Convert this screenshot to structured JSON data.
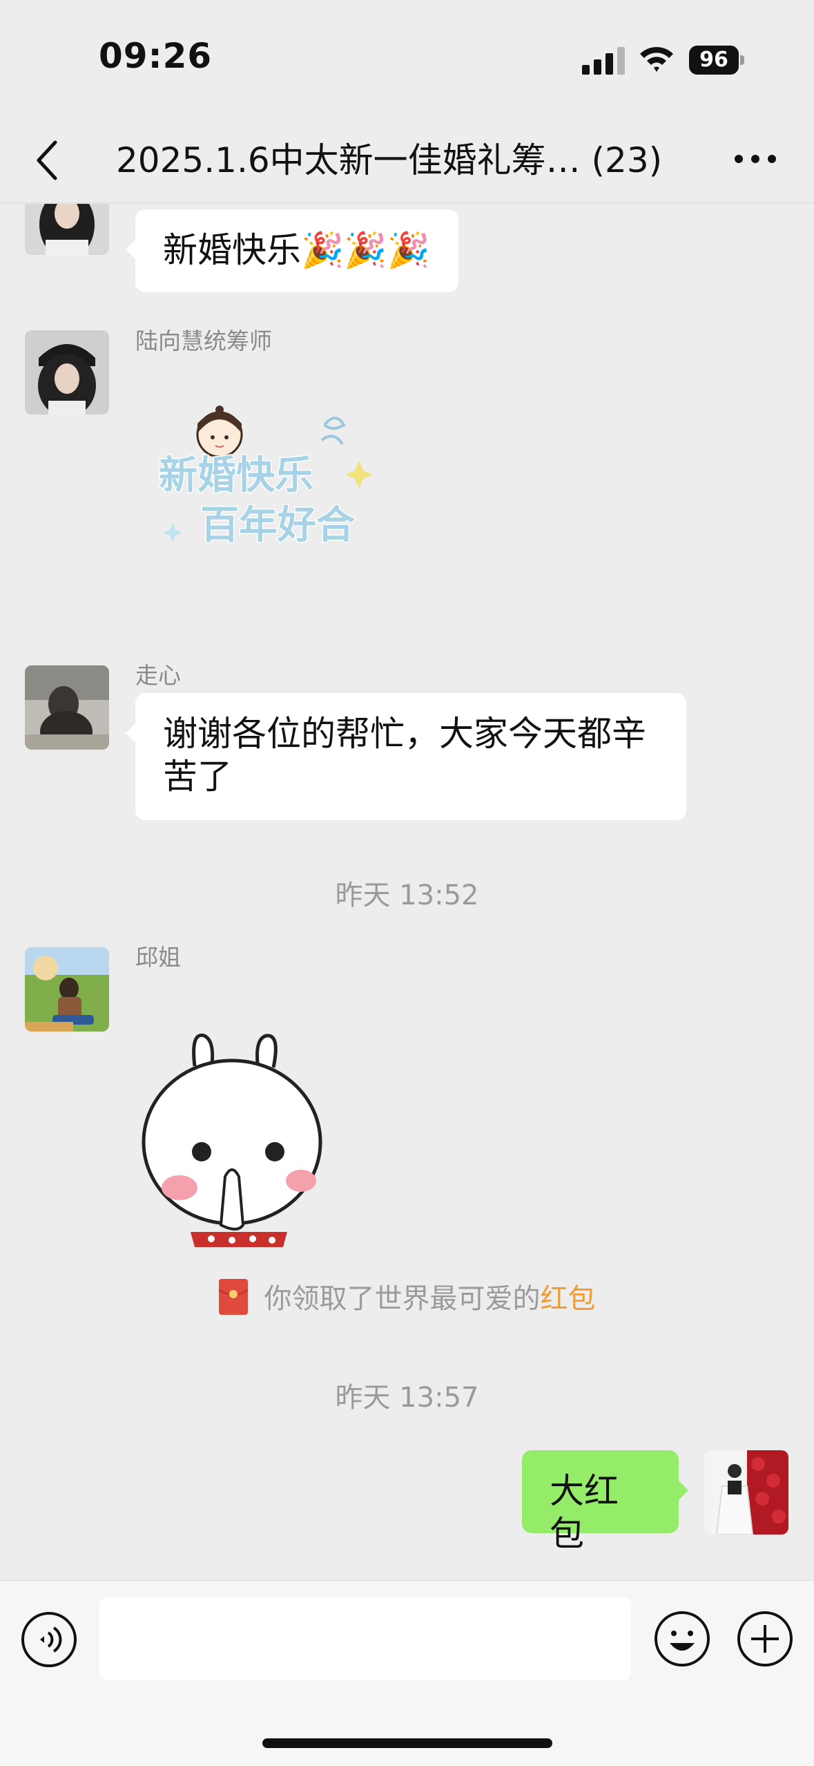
{
  "status_bar": {
    "time": "09:26",
    "battery": "96"
  },
  "header": {
    "title": "2025.1.6中太新一佳婚礼筹… (23)"
  },
  "messages": [
    {
      "type": "text",
      "text": "新婚快乐🎉🎉🎉"
    },
    {
      "type": "sticker",
      "sender": "陆向慧统筹师",
      "sticker_text_line1": "新婚快乐",
      "sticker_text_line2": "百年好合"
    },
    {
      "type": "text",
      "sender": "走心",
      "text_line1": "谢谢各位的帮忙，大家今天都辛",
      "text_line2": "苦了"
    },
    {
      "type": "timestamp",
      "text": "昨天 13:52"
    },
    {
      "type": "sticker",
      "sender": "邱姐"
    },
    {
      "type": "system",
      "prefix": "你领取了世界最可爱的",
      "link": "红包"
    },
    {
      "type": "timestamp",
      "text": "昨天 13:57"
    },
    {
      "type": "text",
      "outgoing": true,
      "text": "大红包"
    }
  ],
  "input_bar": {
    "placeholder": ""
  },
  "colors": {
    "outgoing_bubble": "#95ec69",
    "link": "#f39b33",
    "red_packet": "#e04a3c"
  },
  "icons": [
    "back-icon",
    "more-icon",
    "voice-icon",
    "emoji-icon",
    "plus-icon",
    "red-packet-icon"
  ]
}
